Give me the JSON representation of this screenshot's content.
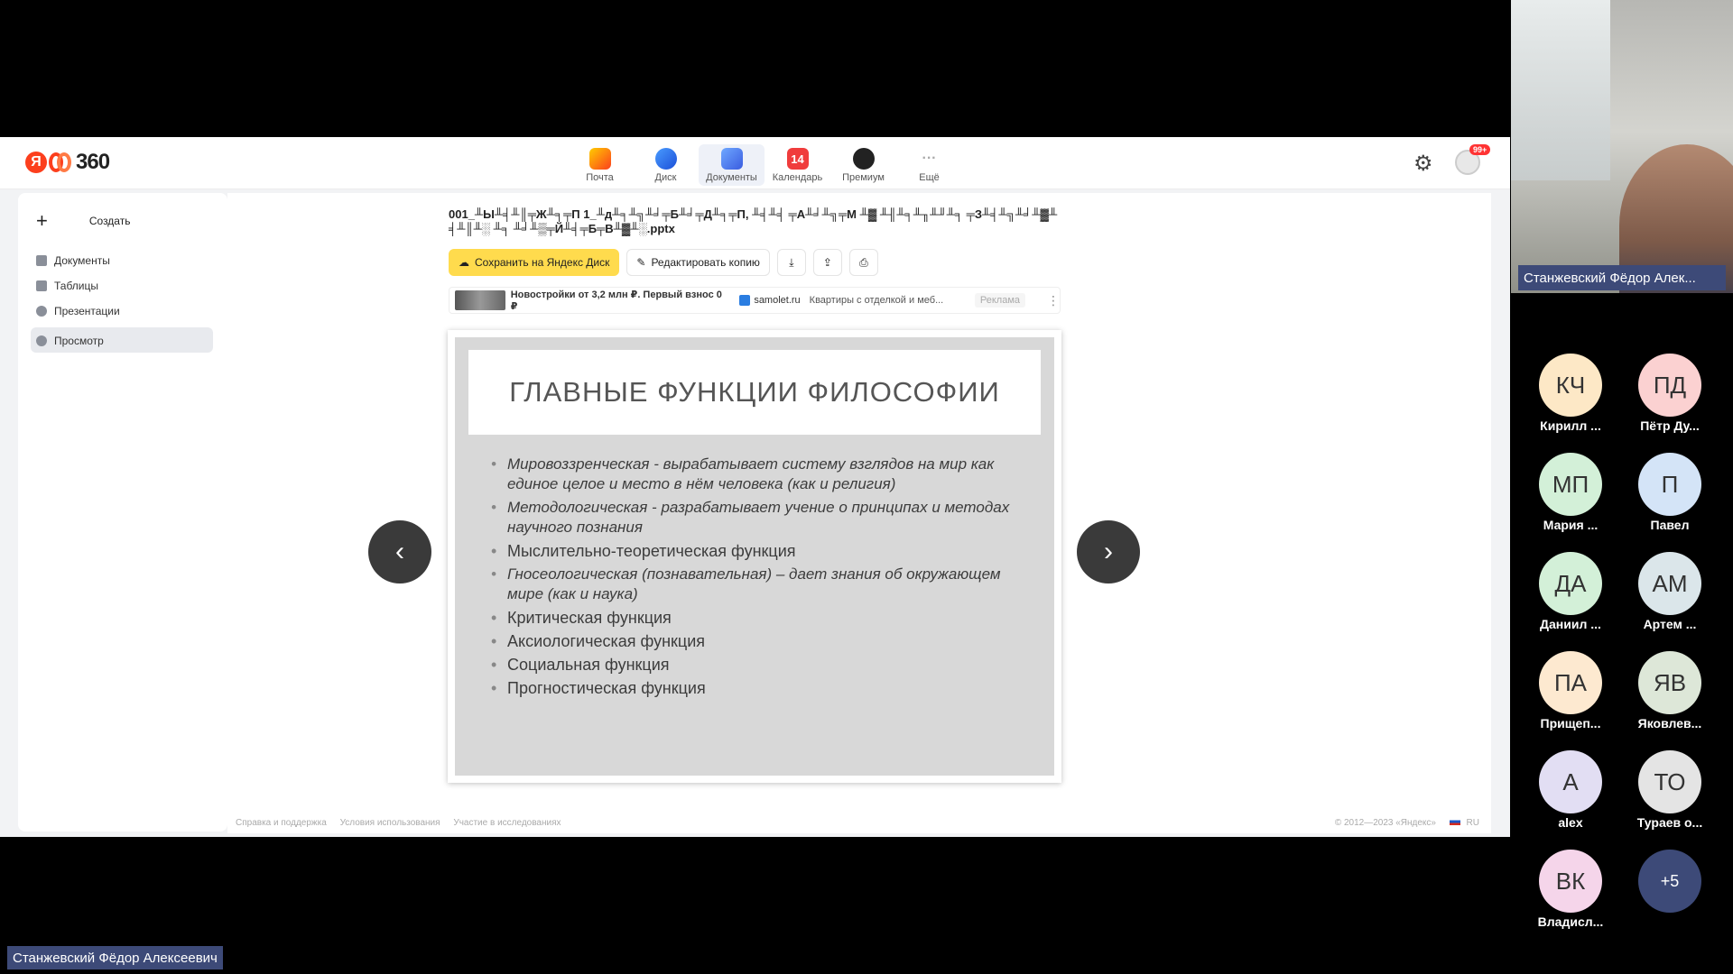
{
  "window": {
    "logo_text": "360",
    "logo_letter": "Я",
    "apps": [
      {
        "label": "Почта",
        "icon": "mail-icon",
        "badge": ""
      },
      {
        "label": "Диск",
        "icon": "disk-icon",
        "badge": ""
      },
      {
        "label": "Документы",
        "icon": "docs-icon",
        "badge": ""
      },
      {
        "label": "Календарь",
        "icon": "calendar-icon",
        "badge": "14"
      },
      {
        "label": "Премиум",
        "icon": "premium-icon",
        "badge": ""
      },
      {
        "label": "Ещё",
        "icon": "more-icon",
        "badge": "···"
      }
    ],
    "notif_badge": "99+"
  },
  "sidebar": {
    "create_label": "Создать",
    "items": [
      {
        "label": "Документы"
      },
      {
        "label": "Таблицы"
      },
      {
        "label": "Презентации"
      },
      {
        "label": "Просмотр"
      }
    ]
  },
  "doc": {
    "filename": "001_╨Ы╨╡╨║╤Ж╨╕╤П 1_╨д╨╕╨╗╨╛╤Б╨╛╤Д╨╕╤П, ╨╡╨╡ ╤А╨╛╨╗╤М ╨▓ ╨╢╨╕╨╖╨╜╨╕ ╤З╨╡╨╗╨╛╨▓╨╡╨║╨░ ╨╕ ╨╛╨▒╤Й╨╡╤Б╤В╨▓╨░.pptx",
    "save_label": "Сохранить на Яндекс Диск",
    "edit_label": "Редактировать копию",
    "ad": {
      "title": "Новостройки от 3,2 млн ₽. Первый взнос 0 ₽",
      "site": "samolet.ru",
      "desc": "Квартиры с отделкой и меб...",
      "label": "Реклама"
    }
  },
  "slide": {
    "title": "ГЛАВНЫЕ ФУНКЦИИ ФИЛОСОФИИ",
    "bullets": [
      {
        "text": "Мировоззренческая   -  вырабатывает систему взглядов на мир как единое целое и место в нём человека (как и религия)",
        "italic": true
      },
      {
        "text": "Методологическая  - разрабатывает учение о принципах и методах научного познания",
        "italic": true
      },
      {
        "text": "Мыслительно-теоретическая функция",
        "italic": false
      },
      {
        "text": "Гносеологическая (познавательная) – дает знания об окружающем мире (как и наука)",
        "italic": true
      },
      {
        "text": "Критическая функция",
        "italic": false
      },
      {
        "text": "Аксиологическая функция",
        "italic": false
      },
      {
        "text": " Социальная функция",
        "italic": false
      },
      {
        "text": "Прогностическая функция",
        "italic": false
      }
    ]
  },
  "footer": {
    "links": [
      "Справка и поддержка",
      "Условия использования",
      "Участие в исследованиях"
    ],
    "copyright": "© 2012—2023 «Яндекс»",
    "lang": "RU"
  },
  "call": {
    "presenter_name": "Станжевский Фёдор Алек...",
    "speaker_name": "Станжевский Фёдор Алексеевич",
    "participants": [
      {
        "initials": "КЧ",
        "name": "Кирилл ...",
        "color": "#fde8c6"
      },
      {
        "initials": "ПД",
        "name": "Пётр Ду...",
        "color": "#fbd1d1"
      },
      {
        "initials": "МП",
        "name": "Мария ...",
        "color": "#d3f0d8"
      },
      {
        "initials": "П",
        "name": "Павел",
        "color": "#d4e4f7"
      },
      {
        "initials": "ДА",
        "name": "Даниил ...",
        "color": "#d3f0d8"
      },
      {
        "initials": "АМ",
        "name": "Артем ...",
        "color": "#dbe6ea"
      },
      {
        "initials": "ПА",
        "name": "Прищеп...",
        "color": "#fde9d0"
      },
      {
        "initials": "ЯВ",
        "name": "Яковлев...",
        "color": "#dde7d8"
      },
      {
        "initials": "А",
        "name": "alex",
        "color": "#e2def3"
      },
      {
        "initials": "ТО",
        "name": "Тураев о...",
        "color": "#e4e4e4"
      },
      {
        "initials": "ВК",
        "name": "Владисл...",
        "color": "#f5d5ea"
      },
      {
        "initials": "+5",
        "name": "",
        "color": "#3d4a78"
      }
    ]
  }
}
